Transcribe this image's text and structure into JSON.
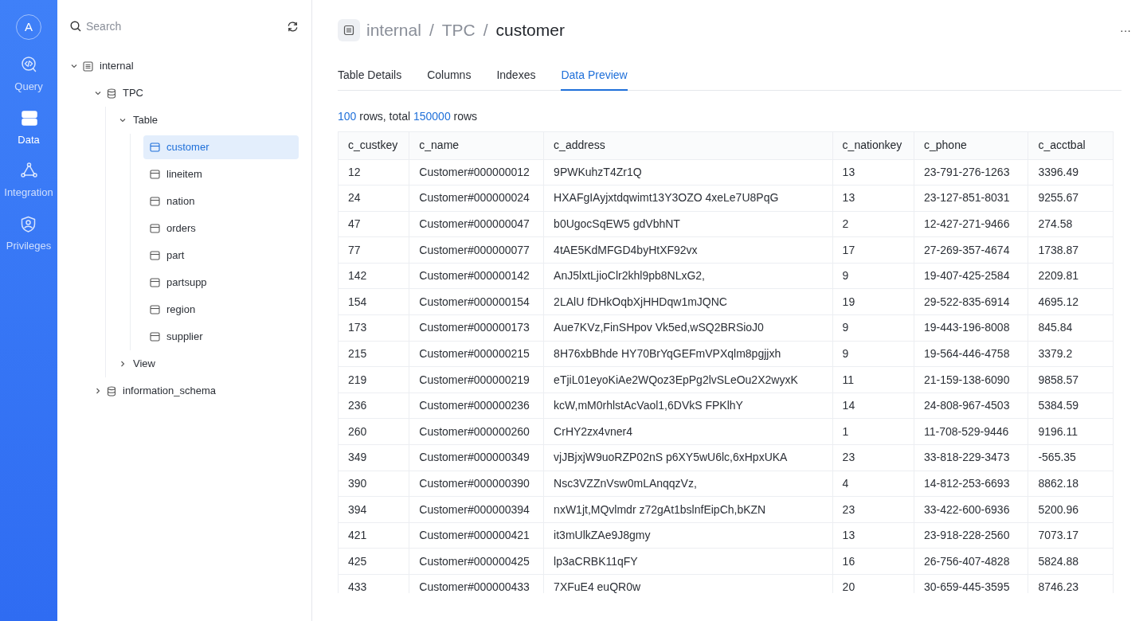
{
  "nav": {
    "avatar": "A",
    "items": [
      {
        "label": "Query",
        "kind": "query",
        "selected": false
      },
      {
        "label": "Data",
        "kind": "data",
        "selected": true
      },
      {
        "label": "Integration",
        "kind": "integration",
        "selected": false
      },
      {
        "label": "Privileges",
        "kind": "privileges",
        "selected": false
      }
    ]
  },
  "sidebar": {
    "search": {
      "placeholder": "Search"
    },
    "tree": [
      {
        "label": "internal",
        "kind": "catalog",
        "expanded": true,
        "children": [
          {
            "label": "TPC",
            "kind": "database",
            "expanded": true,
            "children": [
              {
                "label": "Table",
                "kind": "folder",
                "expanded": true,
                "children": [
                  {
                    "label": "customer",
                    "kind": "table",
                    "selected": true
                  },
                  {
                    "label": "lineitem",
                    "kind": "table",
                    "selected": false
                  },
                  {
                    "label": "nation",
                    "kind": "table",
                    "selected": false
                  },
                  {
                    "label": "orders",
                    "kind": "table",
                    "selected": false
                  },
                  {
                    "label": "part",
                    "kind": "table",
                    "selected": false
                  },
                  {
                    "label": "partsupp",
                    "kind": "table",
                    "selected": false
                  },
                  {
                    "label": "region",
                    "kind": "table",
                    "selected": false
                  },
                  {
                    "label": "supplier",
                    "kind": "table",
                    "selected": false
                  }
                ]
              },
              {
                "label": "View",
                "kind": "folder",
                "expanded": false
              }
            ]
          },
          {
            "label": "information_schema",
            "kind": "database",
            "expanded": false
          }
        ]
      }
    ]
  },
  "header": {
    "breadcrumb": [
      "internal",
      "TPC",
      "customer"
    ],
    "separator": "/",
    "more": "···"
  },
  "tabs": [
    {
      "label": "Table Details",
      "selected": false
    },
    {
      "label": "Columns",
      "selected": false
    },
    {
      "label": "Indexes",
      "selected": false
    },
    {
      "label": "Data Preview",
      "selected": true
    }
  ],
  "summary": [
    {
      "text": "100",
      "kind": "number"
    },
    {
      "text": "rows, total",
      "kind": "text"
    },
    {
      "text": "150000",
      "kind": "number"
    },
    {
      "text": "rows",
      "kind": "text"
    }
  ],
  "table": {
    "columns": [
      "c_custkey",
      "c_name",
      "c_address",
      "c_nationkey",
      "c_phone",
      "c_acctbal"
    ],
    "rows": [
      [
        "12",
        "Customer#000000012",
        "9PWKuhzT4Zr1Q",
        "13",
        "23-791-276-1263",
        "3396.49"
      ],
      [
        "24",
        "Customer#000000024",
        "HXAFgIAyjxtdqwimt13Y3OZO 4xeLe7U8PqG",
        "13",
        "23-127-851-8031",
        "9255.67"
      ],
      [
        "47",
        "Customer#000000047",
        "b0UgocSqEW5 gdVbhNT",
        "2",
        "12-427-271-9466",
        "274.58"
      ],
      [
        "77",
        "Customer#000000077",
        "4tAE5KdMFGD4byHtXF92vx",
        "17",
        "27-269-357-4674",
        "1738.87"
      ],
      [
        "142",
        "Customer#000000142",
        "AnJ5lxtLjioClr2khl9pb8NLxG2,",
        "9",
        "19-407-425-2584",
        "2209.81"
      ],
      [
        "154",
        "Customer#000000154",
        "2LAlU fDHkOqbXjHHDqw1mJQNC",
        "19",
        "29-522-835-6914",
        "4695.12"
      ],
      [
        "173",
        "Customer#000000173",
        "Aue7KVz,FinSHpov Vk5ed,wSQ2BRSioJ0",
        "9",
        "19-443-196-8008",
        "845.84"
      ],
      [
        "215",
        "Customer#000000215",
        "8H76xbBhde HY70BrYqGEFmVPXqlm8pgjjxh",
        "9",
        "19-564-446-4758",
        "3379.2"
      ],
      [
        "219",
        "Customer#000000219",
        "eTjiL01eyoKiAe2WQoz3EpPg2lvSLeOu2X2wyxK",
        "11",
        "21-159-138-6090",
        "9858.57"
      ],
      [
        "236",
        "Customer#000000236",
        "kcW,mM0rhlstAcVaol1,6DVkS FPKlhY",
        "14",
        "24-808-967-4503",
        "5384.59"
      ],
      [
        "260",
        "Customer#000000260",
        "CrHY2zx4vner4",
        "1",
        "11-708-529-9446",
        "9196.11"
      ],
      [
        "349",
        "Customer#000000349",
        "vjJBjxjW9uoRZP02nS p6XY5wU6lc,6xHpxUKA",
        "23",
        "33-818-229-3473",
        "-565.35"
      ],
      [
        "390",
        "Customer#000000390",
        "Nsc3VZZnVsw0mLAnqqzVz,",
        "4",
        "14-812-253-6693",
        "8862.18"
      ],
      [
        "394",
        "Customer#000000394",
        "nxW1jt,MQvlmdr z72gAt1bslnfEipCh,bKZN",
        "23",
        "33-422-600-6936",
        "5200.96"
      ],
      [
        "421",
        "Customer#000000421",
        "it3mUlkZAe9J8gmy",
        "13",
        "23-918-228-2560",
        "7073.17"
      ],
      [
        "425",
        "Customer#000000425",
        "lp3aCRBK11qFY",
        "16",
        "26-756-407-4828",
        "5824.88"
      ],
      [
        "433",
        "Customer#000000433",
        "7XFuE4 euQR0w",
        "20",
        "30-659-445-3595",
        "8746.23"
      ]
    ]
  }
}
